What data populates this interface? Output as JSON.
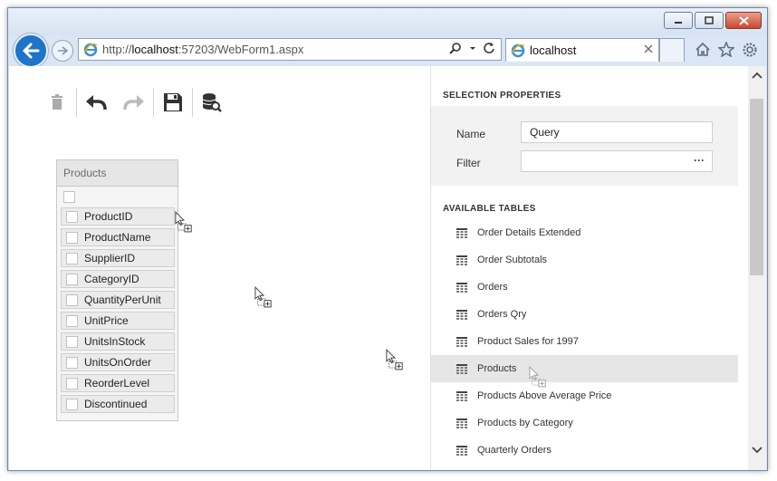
{
  "browser": {
    "address": {
      "protocol": "http://",
      "host": "localhost",
      "rest": ":57203/WebForm1.aspx"
    },
    "tab_title": "localhost",
    "icons": [
      "back-arrow-icon",
      "forward-arrow-icon",
      "ie-logo-icon",
      "search-icon",
      "refresh-icon",
      "close-icon",
      "home-icon",
      "star-icon",
      "gear-icon"
    ]
  },
  "toolbar": {
    "icons": [
      "trash-icon",
      "undo-icon",
      "redo-icon",
      "save-icon",
      "data-source-icon"
    ]
  },
  "table": {
    "title": "Products",
    "fields": [
      "ProductID",
      "ProductName",
      "SupplierID",
      "CategoryID",
      "QuantityPerUnit",
      "UnitPrice",
      "UnitsInStock",
      "UnitsOnOrder",
      "ReorderLevel",
      "Discontinued"
    ]
  },
  "panel": {
    "selection_title": "SELECTION PROPERTIES",
    "name_label": "Name",
    "name_value": "Query",
    "filter_label": "Filter",
    "filter_value": "",
    "filter_button": "···",
    "tables_title": "AVAILABLE TABLES",
    "tables": [
      "Order Details Extended",
      "Order Subtotals",
      "Orders",
      "Orders Qry",
      "Product Sales for 1997",
      "Products",
      "Products Above Average Price",
      "Products by Category",
      "Quarterly Orders"
    ],
    "selected_table": "Products"
  },
  "colors": {
    "accent": "#1e74c8",
    "selected_row": "#e6e6e6"
  }
}
